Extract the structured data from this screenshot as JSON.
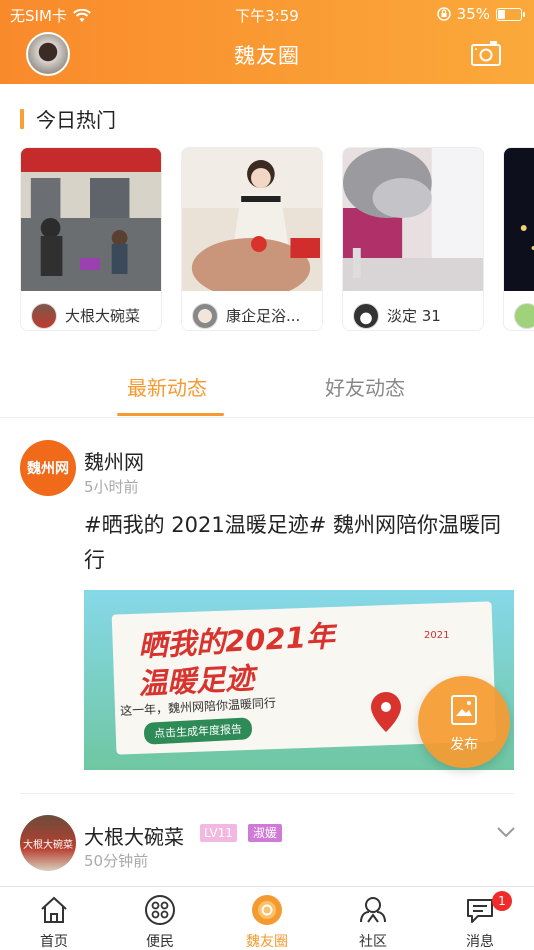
{
  "status_bar": {
    "carrier": "无SIM卡",
    "time": "下午3:59",
    "battery_text": "35%",
    "battery_level": 0.35
  },
  "header": {
    "title": "魏友圈",
    "avatar_icon": "user-avatar",
    "camera_icon": "camera-icon"
  },
  "hot": {
    "title": "今日热门",
    "cards": [
      {
        "author": "大根大碗菜"
      },
      {
        "author": "康企足浴..."
      },
      {
        "author": "淡定 31"
      },
      {
        "author": ""
      }
    ]
  },
  "tabs": [
    {
      "label": "最新动态",
      "active": true
    },
    {
      "label": "好友动态",
      "active": false
    }
  ],
  "post": {
    "avatar_text": "魏州网",
    "author": "魏州网",
    "time": "5小时前",
    "text": "#晒我的 2021温暖足迹# 魏州网陪你温暖同行",
    "banner": {
      "line1": "晒我的2021年",
      "line2": "温暖足迹",
      "sub": "这一年，魏州网陪你温暖同行",
      "button": "点击生成年度报告",
      "year_tag": "2021"
    }
  },
  "fab": {
    "label": "发布"
  },
  "post2": {
    "avatar_text": "大根大碗菜",
    "author": "大根大碗菜",
    "level": "LV11",
    "tag": "淑媛",
    "time": "50分钟前"
  },
  "bottom_nav": [
    {
      "label": "首页",
      "icon": "home-icon",
      "active": false
    },
    {
      "label": "便民",
      "icon": "grid-icon",
      "active": false
    },
    {
      "label": "魏友圈",
      "icon": "circle-icon",
      "active": true
    },
    {
      "label": "社区",
      "icon": "community-icon",
      "active": false
    },
    {
      "label": "消息",
      "icon": "message-icon",
      "active": false,
      "badge": "1"
    }
  ],
  "colors": {
    "accent": "#f59a30",
    "header_start": "#f98a2b",
    "header_end": "#fba93b",
    "badge_red": "#ef2b2b"
  }
}
